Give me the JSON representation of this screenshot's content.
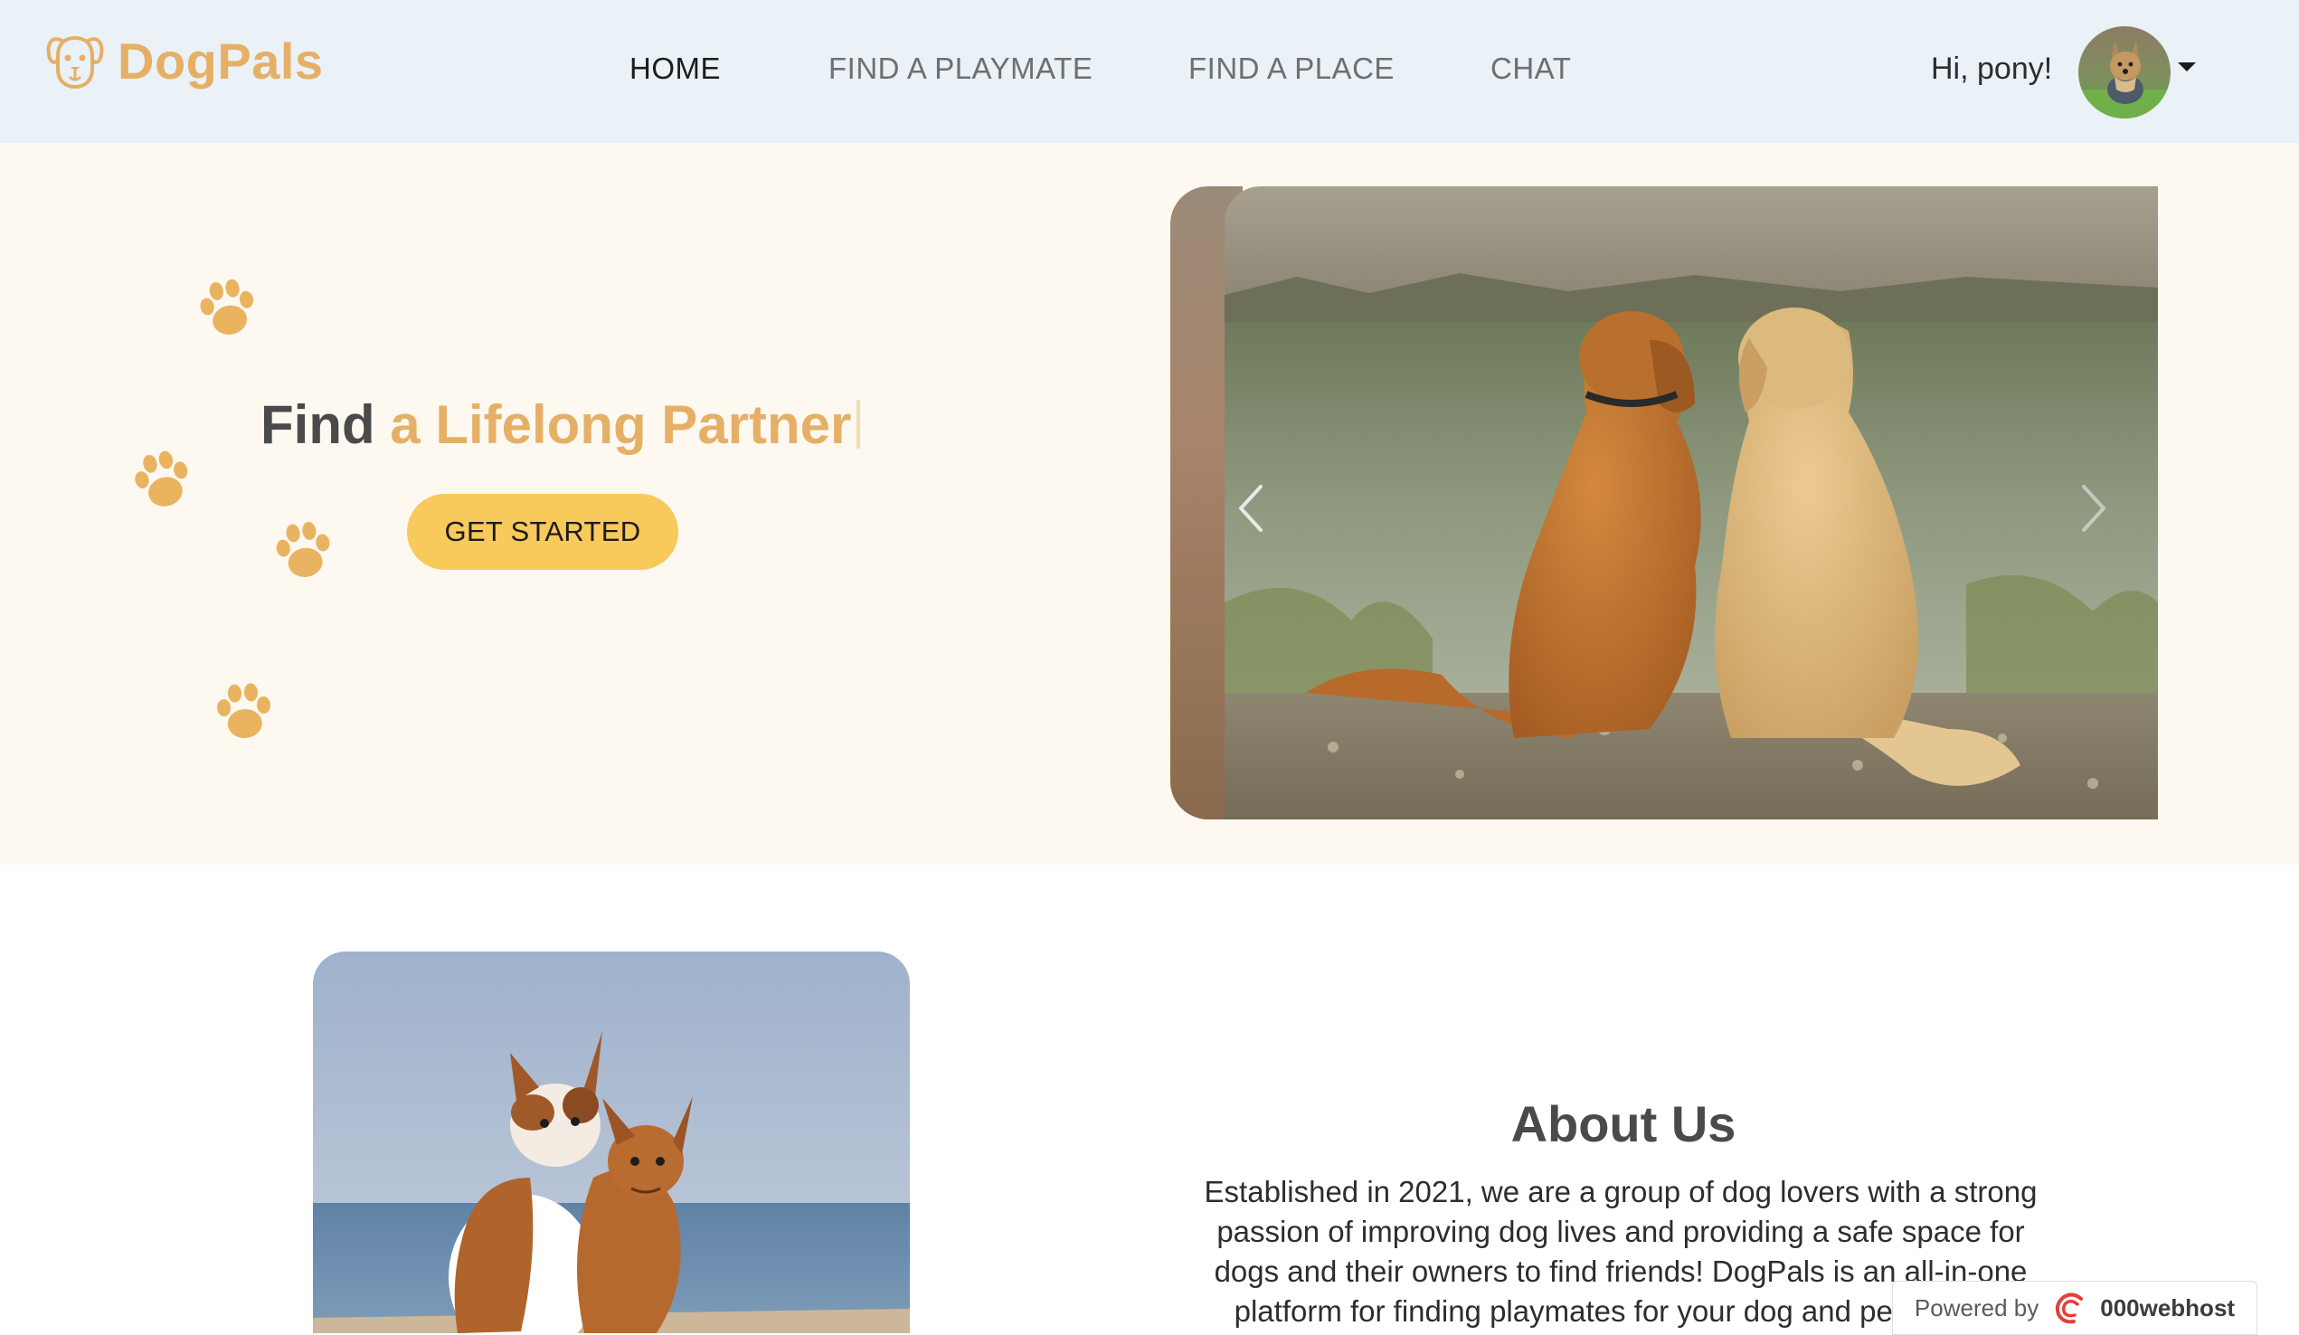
{
  "nav": {
    "brand": "DogPals",
    "links": [
      "HOME",
      "FIND A PLAYMATE",
      "FIND A PLACE",
      "CHAT"
    ],
    "greeting": "Hi, pony!"
  },
  "hero": {
    "headline_plain": "Find ",
    "headline_accent": "a Lifelong Partner",
    "cta_label": "GET STARTED"
  },
  "about": {
    "title": "About Us",
    "body": "Established in 2021, we are a group of dog lovers with a strong passion of improving dog lives and providing a safe space for dogs and their owners to find friends! DogPals is an all-in-one platform for finding playmates for your dog and pet-friendly"
  },
  "badge": {
    "powered_label": "Powered by",
    "host_name": "000webhost"
  },
  "icons": {
    "brand": "dog-face-icon",
    "paw": "paw-print-icon",
    "caret": "caret-down-icon",
    "prev": "chevron-left-icon",
    "next": "chevron-right-icon",
    "host": "webhost-logo-icon"
  },
  "colors": {
    "accent": "#e5b066",
    "cta": "#f8c95b",
    "nav_bg": "#eaf1f7",
    "hero_bg": "#fdf8f0",
    "text_dark": "#2d2d2d"
  }
}
